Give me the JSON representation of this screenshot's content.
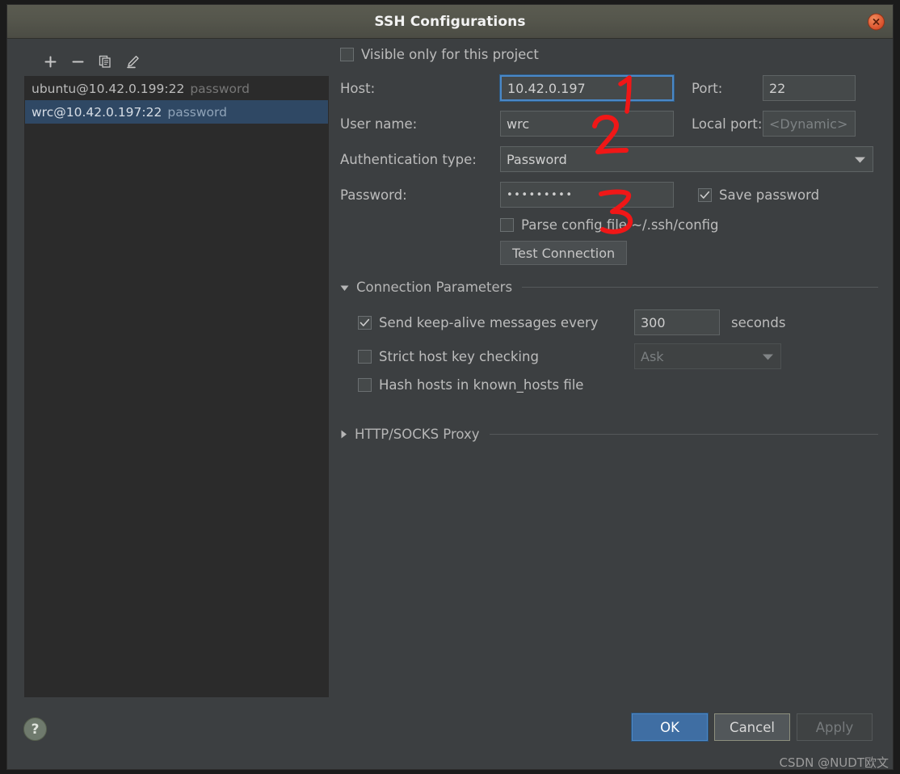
{
  "window": {
    "title": "SSH Configurations",
    "close_icon": "close-x-icon"
  },
  "list_toolbar": {
    "add_label": "+",
    "remove_label": "−",
    "copy_label": "copy-icon",
    "edit_label": "pencil-icon"
  },
  "configs": [
    {
      "name": "ubuntu@10.42.0.199:22",
      "auth": "password",
      "selected": false
    },
    {
      "name": "wrc@10.42.0.197:22",
      "auth": "password",
      "selected": true
    }
  ],
  "form": {
    "visible_only_label": "Visible only for this project",
    "visible_only_checked": false,
    "host_label": "Host:",
    "host_value": "10.42.0.197",
    "port_label": "Port:",
    "port_value": "22",
    "username_label": "User name:",
    "username_value": "wrc",
    "local_port_label": "Local port:",
    "local_port_placeholder": "<Dynamic>",
    "local_port_value": "",
    "auth_type_label": "Authentication type:",
    "auth_type_value": "Password",
    "password_label": "Password:",
    "password_value": "•••••••••",
    "save_password_label": "Save password",
    "save_password_checked": true,
    "parse_config_label": "Parse config file ~/.ssh/config",
    "parse_config_checked": false,
    "test_connection_label": "Test Connection"
  },
  "connection_parameters": {
    "section_title": "Connection Parameters",
    "expanded": true,
    "keepalive_label": "Send keep-alive messages every",
    "keepalive_checked": true,
    "keepalive_value": "300",
    "seconds_label": "seconds",
    "strict_host_label": "Strict host key checking",
    "strict_host_checked": false,
    "strict_host_value": "Ask",
    "hash_hosts_label": "Hash hosts in known_hosts file",
    "hash_hosts_checked": false
  },
  "proxy": {
    "section_title": "HTTP/SOCKS Proxy",
    "expanded": false
  },
  "footer": {
    "help_label": "?",
    "ok_label": "OK",
    "cancel_label": "Cancel",
    "apply_label": "Apply"
  },
  "annotations": [
    {
      "label": "1"
    },
    {
      "label": "2"
    },
    {
      "label": "3"
    }
  ],
  "watermark": "CSDN @NUDT欧文",
  "colors": {
    "accent_blue": "#4a88c7",
    "primary_button": "#3f6ea3",
    "selection": "#2f4864",
    "annotation_red": "#f01717",
    "window_bg": "#3c3f41",
    "list_bg": "#2b2b2b"
  }
}
